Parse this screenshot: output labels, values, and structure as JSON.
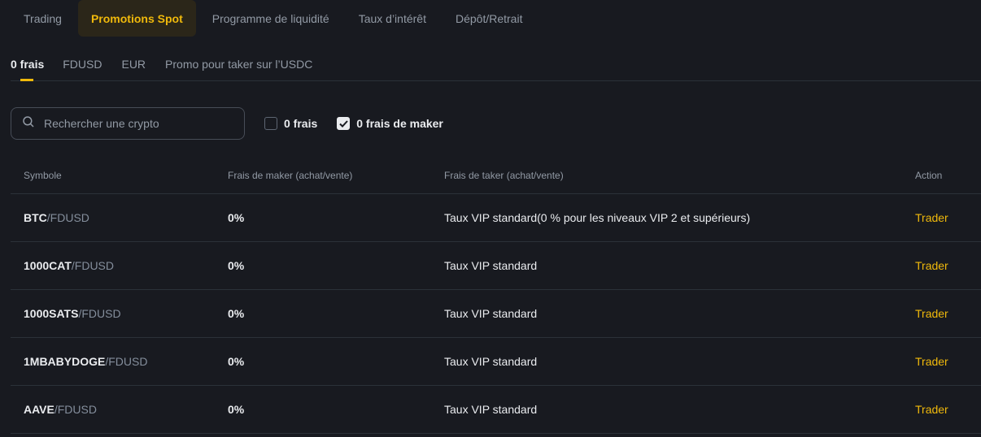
{
  "top_tabs": [
    {
      "label": "Trading",
      "active": false
    },
    {
      "label": "Promotions Spot",
      "active": true
    },
    {
      "label": "Programme de liquidité",
      "active": false
    },
    {
      "label": "Taux d’intérêt",
      "active": false
    },
    {
      "label": "Dépôt/Retrait",
      "active": false
    }
  ],
  "sub_tabs": [
    {
      "label": "0 frais",
      "active": true
    },
    {
      "label": "FDUSD",
      "active": false
    },
    {
      "label": "EUR",
      "active": false
    },
    {
      "label": "Promo pour taker sur l’USDC",
      "active": false
    }
  ],
  "search": {
    "placeholder": "Rechercher une crypto",
    "value": "",
    "icon": "search-icon"
  },
  "filters": [
    {
      "label": "0 frais",
      "checked": false
    },
    {
      "label": "0 frais de maker",
      "checked": true
    }
  ],
  "table": {
    "headers": [
      "Symbole",
      "Frais de maker (achat/vente)",
      "Frais de taker (achat/vente)",
      "Action"
    ],
    "rows": [
      {
        "base": "BTC",
        "quote": "/FDUSD",
        "maker_fee": "0%",
        "taker_fee": "Taux VIP standard(0 % pour les niveaux VIP 2 et supérieurs)",
        "action": "Trader"
      },
      {
        "base": "1000CAT",
        "quote": "/FDUSD",
        "maker_fee": "0%",
        "taker_fee": "Taux VIP standard",
        "action": "Trader"
      },
      {
        "base": "1000SATS",
        "quote": "/FDUSD",
        "maker_fee": "0%",
        "taker_fee": "Taux VIP standard",
        "action": "Trader"
      },
      {
        "base": "1MBABYDOGE",
        "quote": "/FDUSD",
        "maker_fee": "0%",
        "taker_fee": "Taux VIP standard",
        "action": "Trader"
      },
      {
        "base": "AAVE",
        "quote": "/FDUSD",
        "maker_fee": "0%",
        "taker_fee": "Taux VIP standard",
        "action": "Trader"
      }
    ]
  },
  "colors": {
    "accent": "#f0b90b",
    "background": "#181a20",
    "active_tab_bg": "#2b2619",
    "muted_text": "#929aa5"
  }
}
